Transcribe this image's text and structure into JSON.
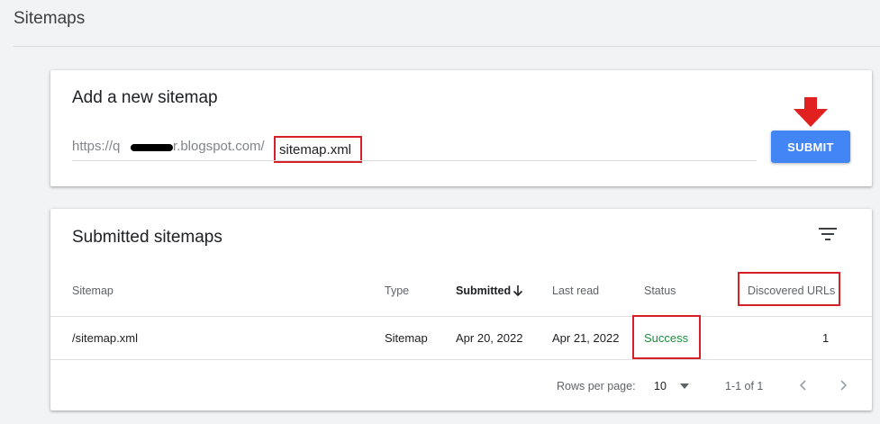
{
  "page": {
    "title": "Sitemaps"
  },
  "add_sitemap": {
    "heading": "Add a new sitemap",
    "url_prefix_start": "https://q",
    "url_prefix_end": "r.blogspot.com/",
    "input_value": "sitemap.xml",
    "submit_label": "SUBMIT",
    "arrow_color": "#e0211f",
    "highlight_color": "#d62027",
    "button_color": "#4285f4"
  },
  "submitted": {
    "heading": "Submitted sitemaps",
    "columns": {
      "sitemap": "Sitemap",
      "type": "Type",
      "submitted": "Submitted",
      "last_read": "Last read",
      "status": "Status",
      "discovered": "Discovered URLs"
    },
    "rows": [
      {
        "sitemap": "/sitemap.xml",
        "type": "Sitemap",
        "submitted": "Apr 20, 2022",
        "last_read": "Apr 21, 2022",
        "status": "Success",
        "discovered": "1"
      }
    ],
    "footer": {
      "rows_per_page_label": "Rows per page:",
      "rows_per_page_value": "10",
      "range": "1-1 of 1"
    },
    "icons": [
      "filter-icon",
      "arrow-down-sort-icon",
      "dropdown-caret-icon",
      "chevron-left-icon",
      "chevron-right-icon"
    ]
  }
}
